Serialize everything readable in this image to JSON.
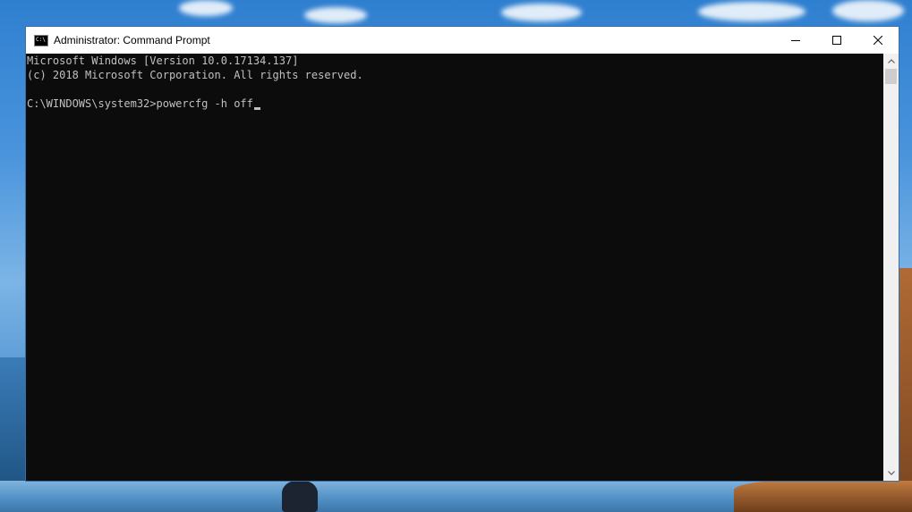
{
  "window": {
    "title": "Administrator: Command Prompt",
    "controls": {
      "minimize_icon": "minimize-icon",
      "maximize_icon": "maximize-icon",
      "close_icon": "close-icon"
    }
  },
  "console": {
    "lines": [
      "Microsoft Windows [Version 10.0.17134.137]",
      "(c) 2018 Microsoft Corporation. All rights reserved.",
      "",
      "C:\\WINDOWS\\system32>powercfg -h off"
    ]
  },
  "colors": {
    "console_bg": "#0c0c0c",
    "console_text": "#c0c0c0",
    "titlebar_bg": "#ffffff"
  }
}
